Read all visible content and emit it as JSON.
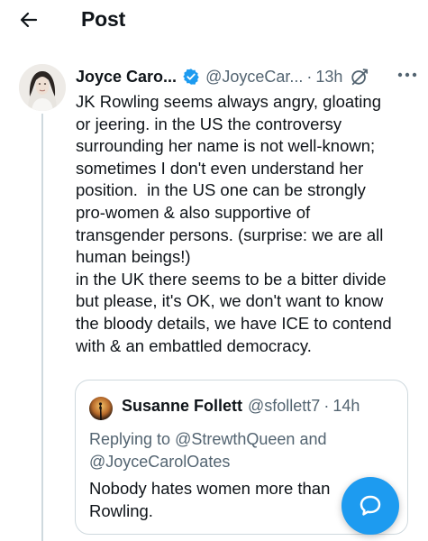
{
  "header": {
    "title": "Post",
    "back_icon": "arrow-left-icon"
  },
  "post": {
    "author_name": "Joyce Caro...",
    "handle": "@JoyceCar...",
    "separator": "·",
    "time": "13h",
    "verified_color": "#1d9bf0",
    "icons": [
      "verified-badge-icon",
      "grok-icon",
      "more-icon"
    ],
    "text_lines": [
      "JK Rowling seems always angry, gloating",
      "or jeering. in the US the controversy",
      "surrounding her name is not well-known;",
      "sometimes I don't even understand her",
      "position.  in the US one can be strongly",
      "pro-women & also supportive of",
      "transgender persons. (surprise: we are all",
      "human beings!)",
      "in the UK there seems to be a bitter divide",
      "but please, it's OK, we don't want to know",
      "the bloody details, we have ICE to contend",
      "with & an embattled democracy."
    ]
  },
  "quote": {
    "author_name": "Susanne Follett",
    "handle": "@sfollett7",
    "separator": "·",
    "time": "14h",
    "replying_prefix": "Replying to",
    "mention_1": "@StrewthQueen",
    "and_word": "and",
    "mention_2": "@JoyceCarolOates",
    "text_line_1": "Nobody hates women more than",
    "text_line_2": "Rowling."
  },
  "fab": {
    "icon": "reply-bubble-icon",
    "color": "#1d9bf0"
  }
}
